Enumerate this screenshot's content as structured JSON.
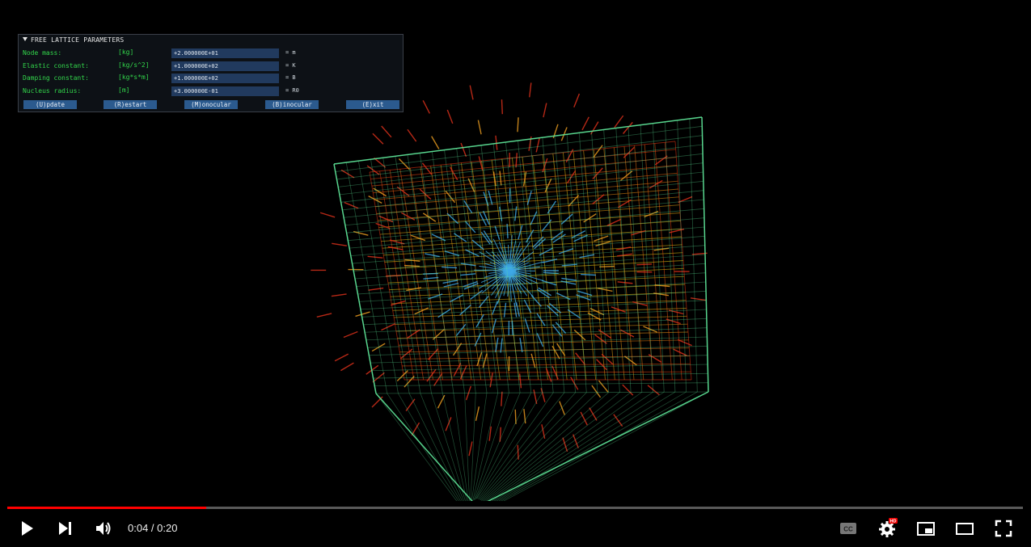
{
  "panel": {
    "title": "FREE LATTICE PARAMETERS",
    "rows": [
      {
        "label": "Node mass:",
        "unit": "[kg]",
        "value": "+2.000000E+01",
        "symbol": "= m"
      },
      {
        "label": "Elastic constant:",
        "unit": "[kg/s^2]",
        "value": "+1.000000E+02",
        "symbol": "= K"
      },
      {
        "label": "Damping constant:",
        "unit": "[kg*s*m]",
        "value": "+1.000000E+02",
        "symbol": "= B"
      },
      {
        "label": "Nucleus radius:",
        "unit": "[m]",
        "value": "+3.000000E-01",
        "symbol": "= R0"
      }
    ],
    "buttons": [
      "(U)pdate",
      "(R)estart",
      "(M)onocular",
      "(B)inocular",
      "(E)xit"
    ]
  },
  "player": {
    "time": "0:04 / 0:20",
    "progress": 0.196,
    "hd_badge": "HD",
    "icons": [
      "play-icon",
      "next-icon",
      "volume-icon",
      "cc-icon",
      "settings-icon",
      "miniplayer-icon",
      "theater-icon",
      "fullscreen-icon"
    ]
  },
  "colors": {
    "played": "#ff0000",
    "lattice": "#5fe89a",
    "vector_hot": "#e4321c",
    "core": "#3fa9e6"
  }
}
